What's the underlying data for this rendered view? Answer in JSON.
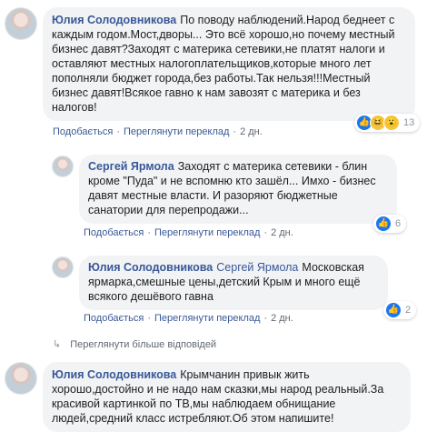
{
  "actions": {
    "like": "Подобається",
    "translate": "Переглянути переклад",
    "separator": "·"
  },
  "comments": [
    {
      "author": "Юлия Солодовникова",
      "text": "По поводу наблюдений.Народ беднеет с каждым годом.Мост,дворы... Это всё хорошо,но почему местный бизнес давят?Заходят с материка сетевики,не платят налоги и оставляют местных налогоплательщиков,которые много лет пополняли бюджет города,без работы.Так нельзя!!!Местный бизнес давят!Всякое гавно к нам завозят с материка и без налогов!",
      "time": "2 дн.",
      "reaction_count": "13",
      "reactions": [
        "like-icon",
        "haha-icon",
        "wow-icon"
      ]
    },
    {
      "author": "Сергей Ярмола",
      "text": "Заходят с материка сетевики - блин кроме \"Пуда\" и не вспомню кто зашёл... Имхо - бизнес давят местные власти. И разоряют бюджетные санатории для перепродажи...",
      "time": "2 дн.",
      "reaction_count": "6",
      "reactions": [
        "like-icon"
      ]
    },
    {
      "author": "Юлия Солодовникова",
      "mention": "Сергей Ярмола",
      "text": "Московская ярмарка,смешные цены,детский Крым и много ещё всякого дешёвого гавна",
      "time": "2 дн.",
      "reaction_count": "2",
      "reactions": [
        "like-icon"
      ]
    },
    {
      "author": "Юлия Солодовникова",
      "text": "Крымчанин привык жить хорошо,достойно и не надо нам сказки,мы народ реальный.За красивой картинкой по ТВ,мы наблюдаем обнищание людей,средний класс истребляют.Об этом напишите!"
    }
  ],
  "more_replies": "Переглянути більше відповідей",
  "colors": {
    "link": "#385898",
    "bubble": "#f2f3f5",
    "meta": "#606770",
    "like": "#1877f2"
  }
}
